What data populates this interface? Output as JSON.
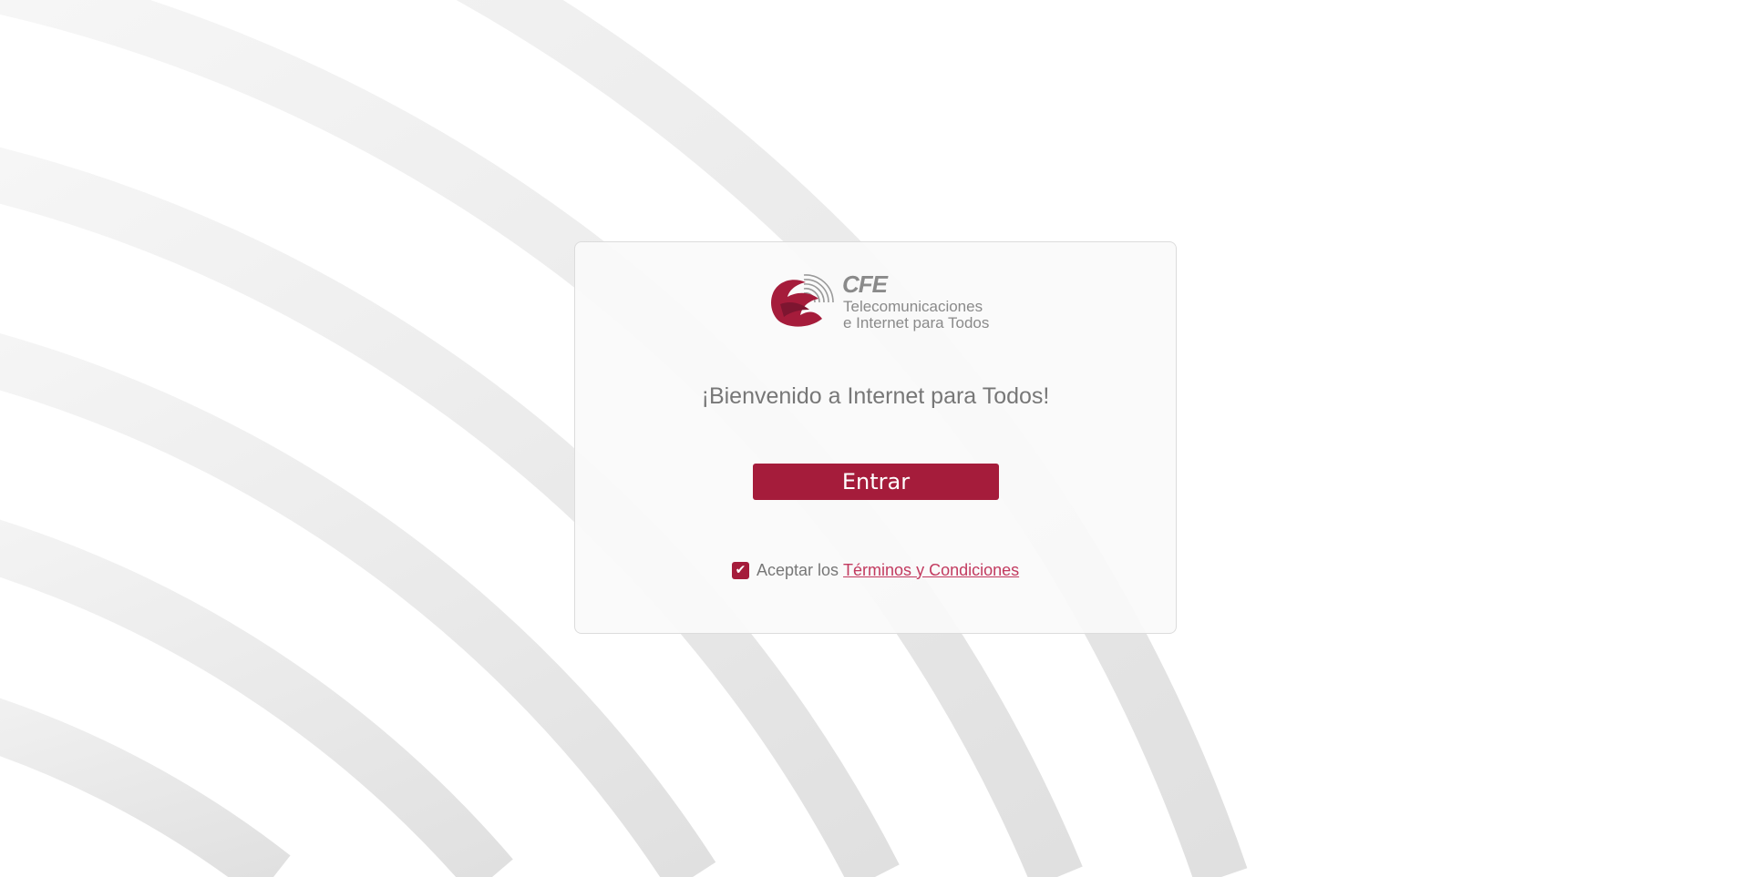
{
  "colors": {
    "brand": "#a51c3b",
    "text_gray": "#777777",
    "link": "#c23a5f",
    "background_arcs": "#e3e3e3"
  },
  "logo": {
    "icon": "cfe-eagle-icon",
    "brand": "CFE",
    "line1": "Telecomunicaciones",
    "line2": "e Internet para Todos"
  },
  "welcome": "¡Bienvenido a Internet para Todos!",
  "enter_button": "Entrar",
  "terms": {
    "checked": true,
    "check_glyph": "✔",
    "prefix": "Aceptar los",
    "link_text": "Términos y Condiciones"
  }
}
